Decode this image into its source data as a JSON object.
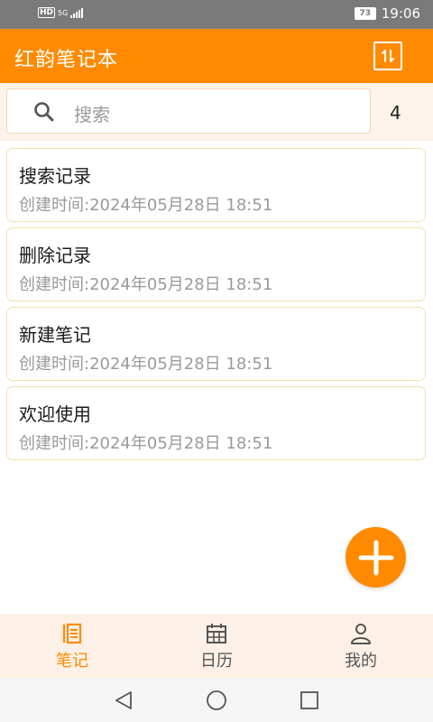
{
  "status_bar": {
    "hd": "HD",
    "network": "5G",
    "battery": "73",
    "time": "19:06"
  },
  "app_bar": {
    "title": "红韵笔记本",
    "sort_icon": "sort-updown-icon"
  },
  "search": {
    "placeholder": "搜索",
    "count": "4"
  },
  "notes": [
    {
      "title": "搜索记录",
      "time": "创建时间:2024年05月28日 18:51"
    },
    {
      "title": "删除记录",
      "time": "创建时间:2024年05月28日 18:51"
    },
    {
      "title": "新建笔记",
      "time": "创建时间:2024年05月28日 18:51"
    },
    {
      "title": "欢迎使用",
      "time": "创建时间:2024年05月28日 18:51"
    }
  ],
  "fab": {
    "icon": "plus-icon"
  },
  "bottom_nav": [
    {
      "label": "笔记",
      "icon": "notes-list-icon",
      "active": true
    },
    {
      "label": "日历",
      "icon": "calendar-icon",
      "active": false
    },
    {
      "label": "我的",
      "icon": "person-icon",
      "active": false
    }
  ],
  "colors": {
    "accent": "#ff8a00",
    "inactive_nav": "#555555",
    "secondary_text": "#9a9a9a"
  }
}
